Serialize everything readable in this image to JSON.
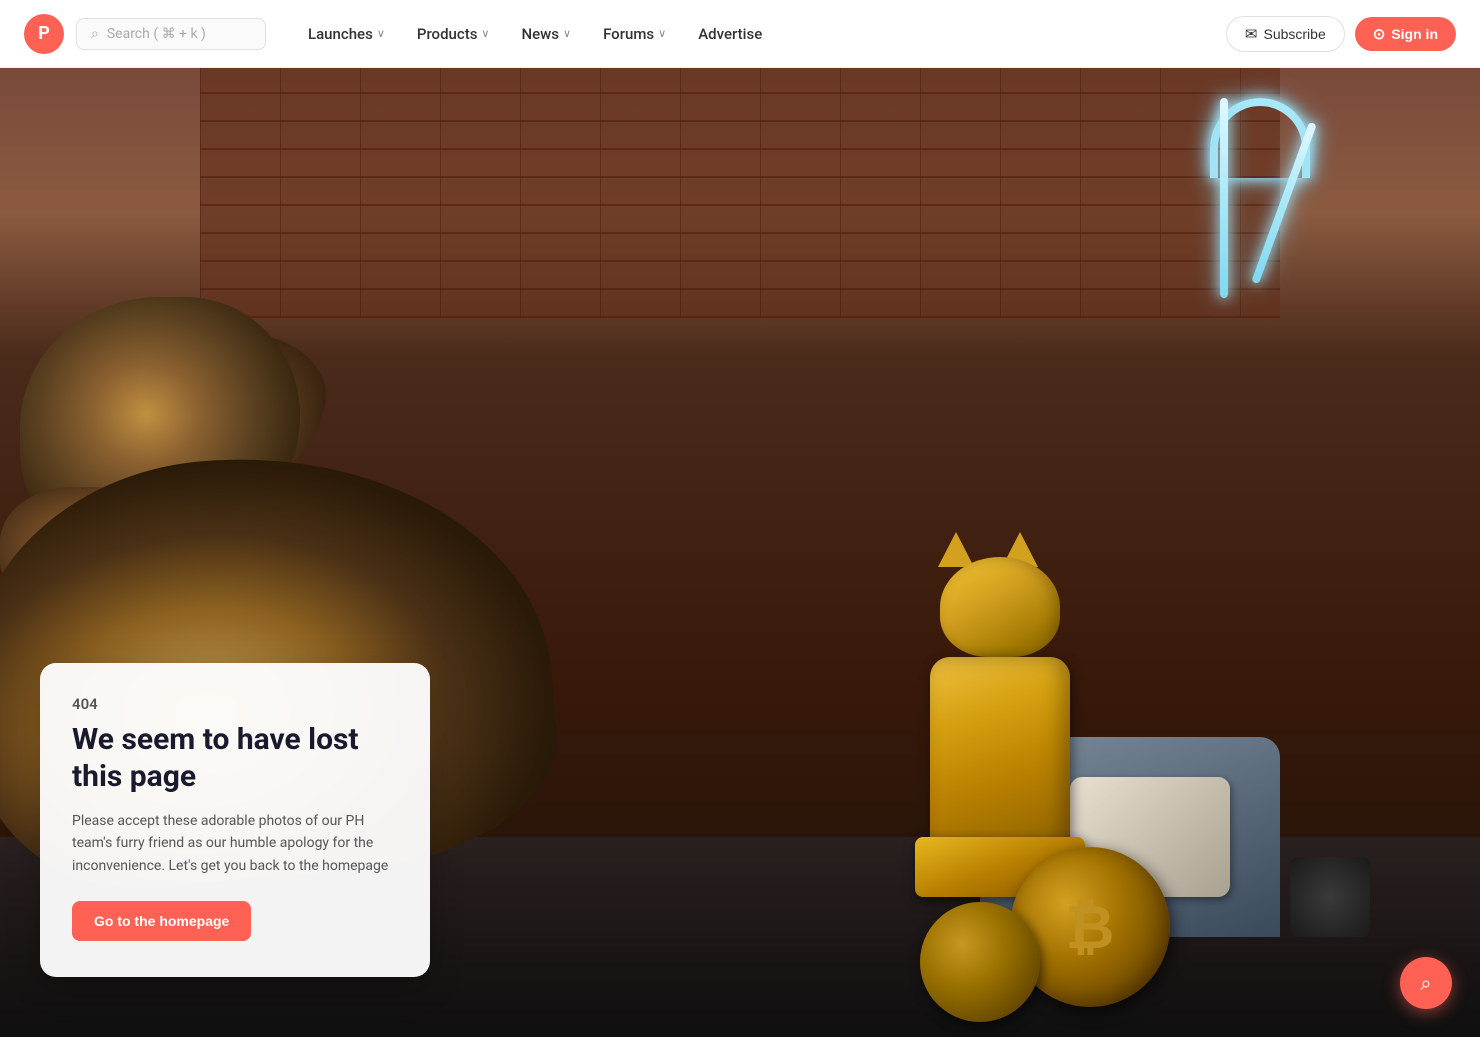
{
  "nav": {
    "logo_letter": "P",
    "search_placeholder": "Search ( ⌘ + k )",
    "items": [
      {
        "label": "Launches",
        "has_chevron": true
      },
      {
        "label": "Products",
        "has_chevron": true
      },
      {
        "label": "News",
        "has_chevron": true
      },
      {
        "label": "Forums",
        "has_chevron": true
      },
      {
        "label": "Advertise",
        "has_chevron": false
      }
    ],
    "subscribe_label": "Subscribe",
    "signin_label": "Sign in"
  },
  "error_page": {
    "code": "404",
    "title": "We seem to have lost this page",
    "description": "Please accept these adorable photos of our PH team's furry friend as our humble apology for the inconvenience. Let's get you back to the homepage",
    "cta_label": "Go to the homepage"
  },
  "icons": {
    "search": "🔍",
    "subscribe_icon": "✉",
    "signin_icon": "→",
    "chevron": "›",
    "bitcoin": "₿",
    "fab_search": "🔍"
  }
}
